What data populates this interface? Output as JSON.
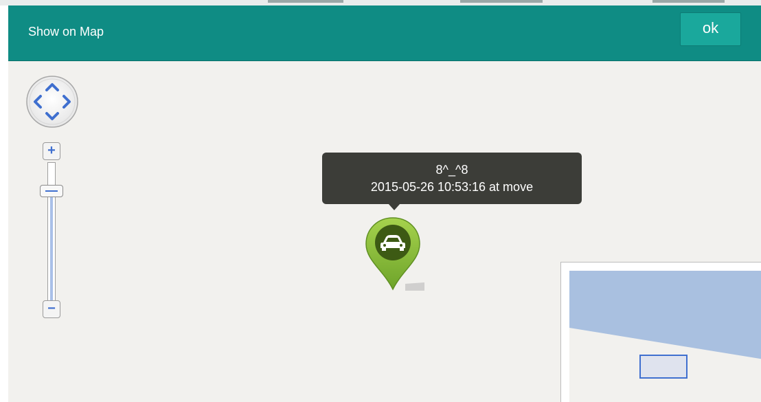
{
  "dialog": {
    "title": "Show on Map",
    "ok_label": "ok"
  },
  "map": {
    "controls": {
      "zoom_in_symbol": "+",
      "zoom_out_symbol": "−",
      "pan_icon": "pan-arrows-icon",
      "zoom_level_fraction": 0.82
    },
    "tooltip": {
      "name": "8^_^8",
      "status": "2015-05-26 10:53:16 at move"
    },
    "marker_icon": "car-icon",
    "colors": {
      "header": "#0f8c84",
      "ok_button": "#1aa89c",
      "map_bg": "#f2f1ee",
      "marker": "#7fb735",
      "water": "#a9c0e0",
      "tooltip_bg": "#3c3d38"
    }
  }
}
